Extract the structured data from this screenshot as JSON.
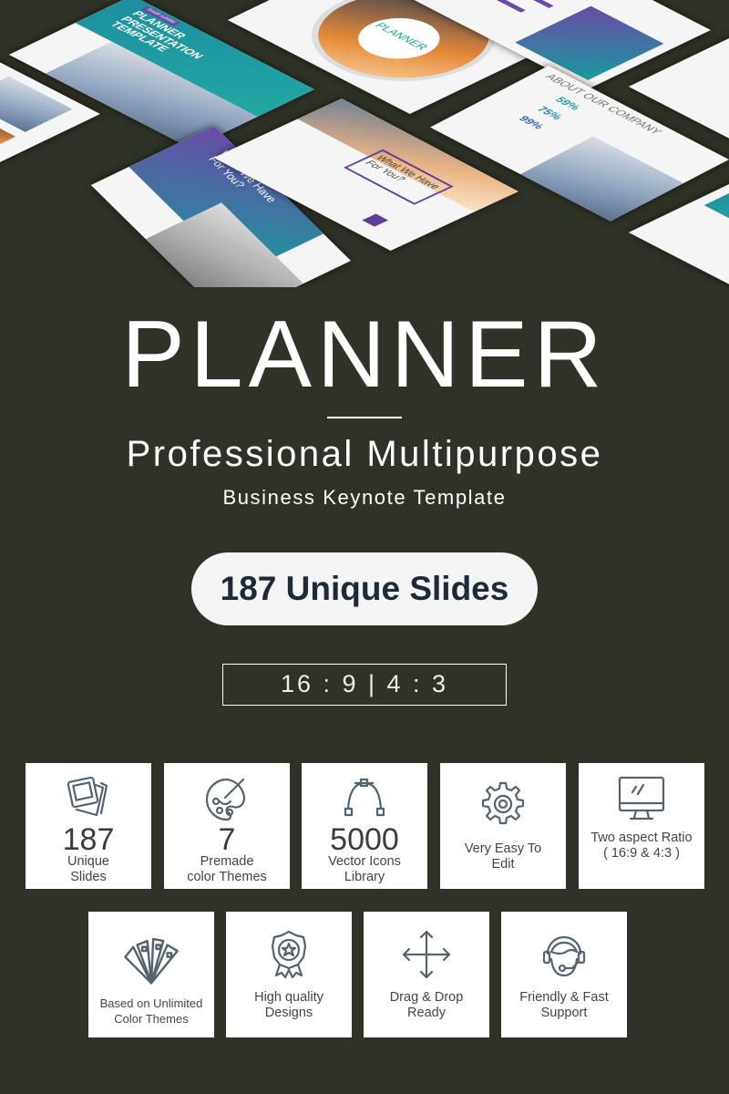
{
  "mockups": {
    "cover_badge": "Small subtitle",
    "cover_title": "PLANNER PRESENTATION TEMPLATE",
    "circle_title": "PLANNER",
    "about_title": "ABOUT OUR COMPANY",
    "stats": [
      "59%",
      "75%",
      "99%"
    ],
    "what_we_have": "What We Have For You?"
  },
  "hero": {
    "title": "PLANNER",
    "subtitle": "Professional Multipurpose",
    "tagline": "Business Keynote Template",
    "pill": "187 Unique Slides",
    "ratios": "16 : 9 |  4 : 3"
  },
  "colors": {
    "background": "#2f3226",
    "icon": "#55626f",
    "pill_text": "#1f2a38"
  },
  "features": [
    {
      "icon": "slides-icon",
      "number": "187",
      "label": "Unique Slides"
    },
    {
      "icon": "palette-icon",
      "number": "7",
      "label": "Premade color Themes"
    },
    {
      "icon": "vector-pen-icon",
      "number": "5000",
      "label": "Vector Icons Library"
    },
    {
      "icon": "gear-icon",
      "label": "Very Easy To Edit"
    },
    {
      "icon": "monitor-icon",
      "label": "Two aspect Ratio ( 16:9 & 4:3 )"
    },
    {
      "icon": "color-swatch-icon",
      "label": "Based on Unlimited Color Themes"
    },
    {
      "icon": "award-badge-icon",
      "label": "High quality Designs"
    },
    {
      "icon": "move-arrows-icon",
      "label": "Drag & Drop Ready"
    },
    {
      "icon": "headset-icon",
      "label": "Friendly & Fast Support"
    }
  ]
}
